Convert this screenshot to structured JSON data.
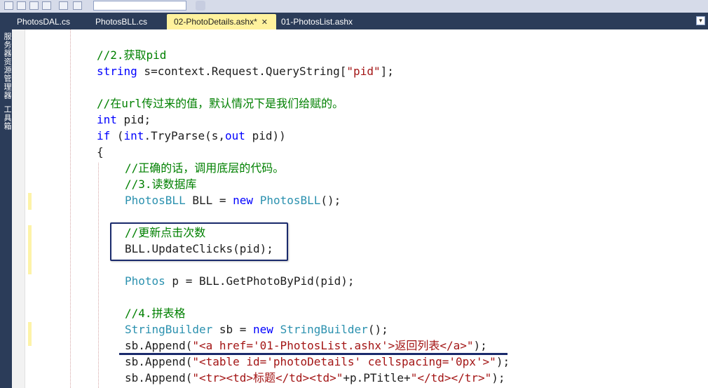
{
  "tabs": [
    {
      "label": "PhotosDAL.cs",
      "active": false
    },
    {
      "label": "PhotosBLL.cs",
      "active": false
    },
    {
      "label": "02-PhotoDetails.ashx*",
      "active": true
    },
    {
      "label": "01-PhotosList.ashx",
      "active": false
    }
  ],
  "side_panels": [
    "服务器资源管理器",
    "工具箱"
  ],
  "colors": {
    "comment": "#008000",
    "keyword": "#0000ff",
    "type": "#2b91af",
    "string": "#a31515",
    "tab_active": "#fff29d",
    "tab_bar": "#2b3c59",
    "annotation": "#1a2a6c"
  },
  "code": {
    "l01": "//2.获取pid",
    "l02_kw": "string",
    "l02_mid": " s=context.Request.QueryString[",
    "l02_str": "\"pid\"",
    "l02_end": "];",
    "l04": "//在url传过来的值，默认情况下是我们给赋的。",
    "l05_kw": "int",
    "l05_end": " pid;",
    "l06_kw1": "if",
    "l06_mid1": " (",
    "l06_kw2": "int",
    "l06_mid2": ".TryParse(s,",
    "l06_kw3": "out",
    "l06_end": " pid))",
    "l07": "{",
    "l08": "//正确的话，调用底层的代码。",
    "l09": "//3.读数据库",
    "l10_type1": "PhotosBLL",
    "l10_mid": " BLL = ",
    "l10_kw": "new",
    "l10_sp": " ",
    "l10_type2": "PhotosBLL",
    "l10_end": "();",
    "l12": "//更新点击次数",
    "l13": "BLL.UpdateClicks(pid);",
    "l15_type": "Photos",
    "l15_end": " p = BLL.GetPhotoByPid(pid);",
    "l17": "//4.拼表格",
    "l18_type1": "StringBuilder",
    "l18_mid": " sb = ",
    "l18_kw": "new",
    "l18_sp": " ",
    "l18_type2": "StringBuilder",
    "l18_end": "();",
    "l19_pre": "sb.Append(",
    "l19_str": "\"<a href='01-PhotosList.ashx'>返回列表</a>\"",
    "l19_end": ");",
    "l20_pre": "sb.Append(",
    "l20_str": "\"<table id='photoDetails' cellspacing='0px'>\"",
    "l20_end": ");",
    "l21_pre": "sb.Append(",
    "l21_str1": "\"<tr><td>标题</td><td>\"",
    "l21_mid": "+p.PTitle+",
    "l21_str2": "\"</td></tr>\"",
    "l21_end": ");"
  }
}
